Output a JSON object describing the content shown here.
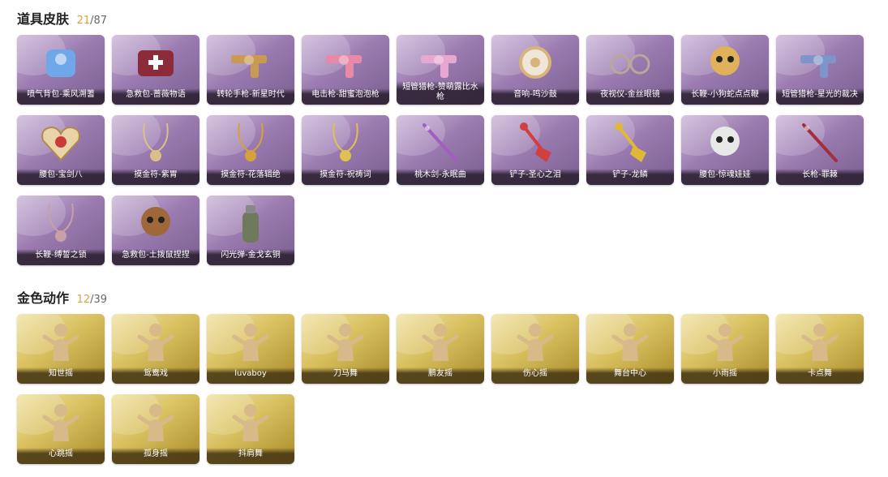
{
  "sections": [
    {
      "title": "道具皮肤",
      "count_current": "21",
      "count_sep": "/",
      "count_total": "87",
      "items": [
        {
          "label": "喷气背包-乘风溯蓍",
          "icon": "jetpack-icon",
          "color": "#6fa8e8"
        },
        {
          "label": "急救包-蔷薇物语",
          "icon": "medkit-icon",
          "color": "#8c2c3a"
        },
        {
          "label": "转轮手枪-新星时代",
          "icon": "revolver-icon",
          "color": "#c89a52"
        },
        {
          "label": "电击枪-甜蜜泡泡枪",
          "icon": "taser-icon",
          "color": "#e889a8"
        },
        {
          "label": "短管猎枪-赞萌露比水枪",
          "icon": "shotgun-icon",
          "color": "#e6a7d0"
        },
        {
          "label": "音响-鸣沙鼓",
          "icon": "speaker-icon",
          "color": "#d8b37a"
        },
        {
          "label": "夜视仪-金丝眼镜",
          "icon": "glasses-icon",
          "color": "#b9a89a"
        },
        {
          "label": "长鞭-小狗蛇点点鞭",
          "icon": "snake-whip-icon",
          "color": "#e0b05a"
        },
        {
          "label": "短管猎枪-星光的裁决",
          "icon": "shotgun-icon",
          "color": "#7d95c8"
        },
        {
          "label": "腰包-宝剑八",
          "icon": "heart-pouch-icon",
          "color": "#c93b3b"
        },
        {
          "label": "摸金符-紫胃",
          "icon": "amulet-icon",
          "color": "#d9c08a"
        },
        {
          "label": "摸金符-花落辑绝",
          "icon": "amulet-icon",
          "color": "#d4a23a"
        },
        {
          "label": "摸金符-祝祷词",
          "icon": "amulet-icon",
          "color": "#e0c050"
        },
        {
          "label": "桃木剑-永眠曲",
          "icon": "sword-icon",
          "color": "#a05fc0"
        },
        {
          "label": "铲子-圣心之泪",
          "icon": "shovel-icon",
          "color": "#d04040"
        },
        {
          "label": "铲子-龙鳞",
          "icon": "shovel-icon",
          "color": "#e0b838"
        },
        {
          "label": "腰包-惊魂娃娃",
          "icon": "doll-pouch-icon",
          "color": "#e8e8e8"
        },
        {
          "label": "长枪-罪棘",
          "icon": "spear-icon",
          "color": "#a03040"
        },
        {
          "label": "长鞭-缚誓之锁",
          "icon": "chain-whip-icon",
          "color": "#c8a0a8"
        },
        {
          "label": "急救包-土拨鼠捏捏",
          "icon": "groundhog-icon",
          "color": "#a06838"
        },
        {
          "label": "闪光弹-金戈玄铜",
          "icon": "grenade-icon",
          "color": "#6e7a5a"
        }
      ]
    },
    {
      "title": "金色动作",
      "count_current": "12",
      "count_sep": "/",
      "count_total": "39",
      "items": [
        {
          "label": "知世摇",
          "icon": "dance-pose-icon"
        },
        {
          "label": "鸳鸯戏",
          "icon": "dance-pose-icon"
        },
        {
          "label": "luvaboy",
          "icon": "dance-pose-icon"
        },
        {
          "label": "刀马舞",
          "icon": "dance-pose-icon"
        },
        {
          "label": "鹏友摇",
          "icon": "dance-pose-icon"
        },
        {
          "label": "伤心摇",
          "icon": "dance-pose-icon"
        },
        {
          "label": "舞台中心",
          "icon": "dance-pose-icon"
        },
        {
          "label": "小雨摇",
          "icon": "dance-pose-icon"
        },
        {
          "label": "卡点舞",
          "icon": "dance-pose-icon"
        },
        {
          "label": "心跳摇",
          "icon": "dance-pose-icon"
        },
        {
          "label": "孤身摇",
          "icon": "dance-pose-icon"
        },
        {
          "label": "抖肩舞",
          "icon": "dance-pose-icon"
        }
      ]
    }
  ],
  "colors": {
    "accent_count": "#e0a23c",
    "purple_card": "#9b7bb0",
    "gold_card": "#d8bf5d"
  }
}
